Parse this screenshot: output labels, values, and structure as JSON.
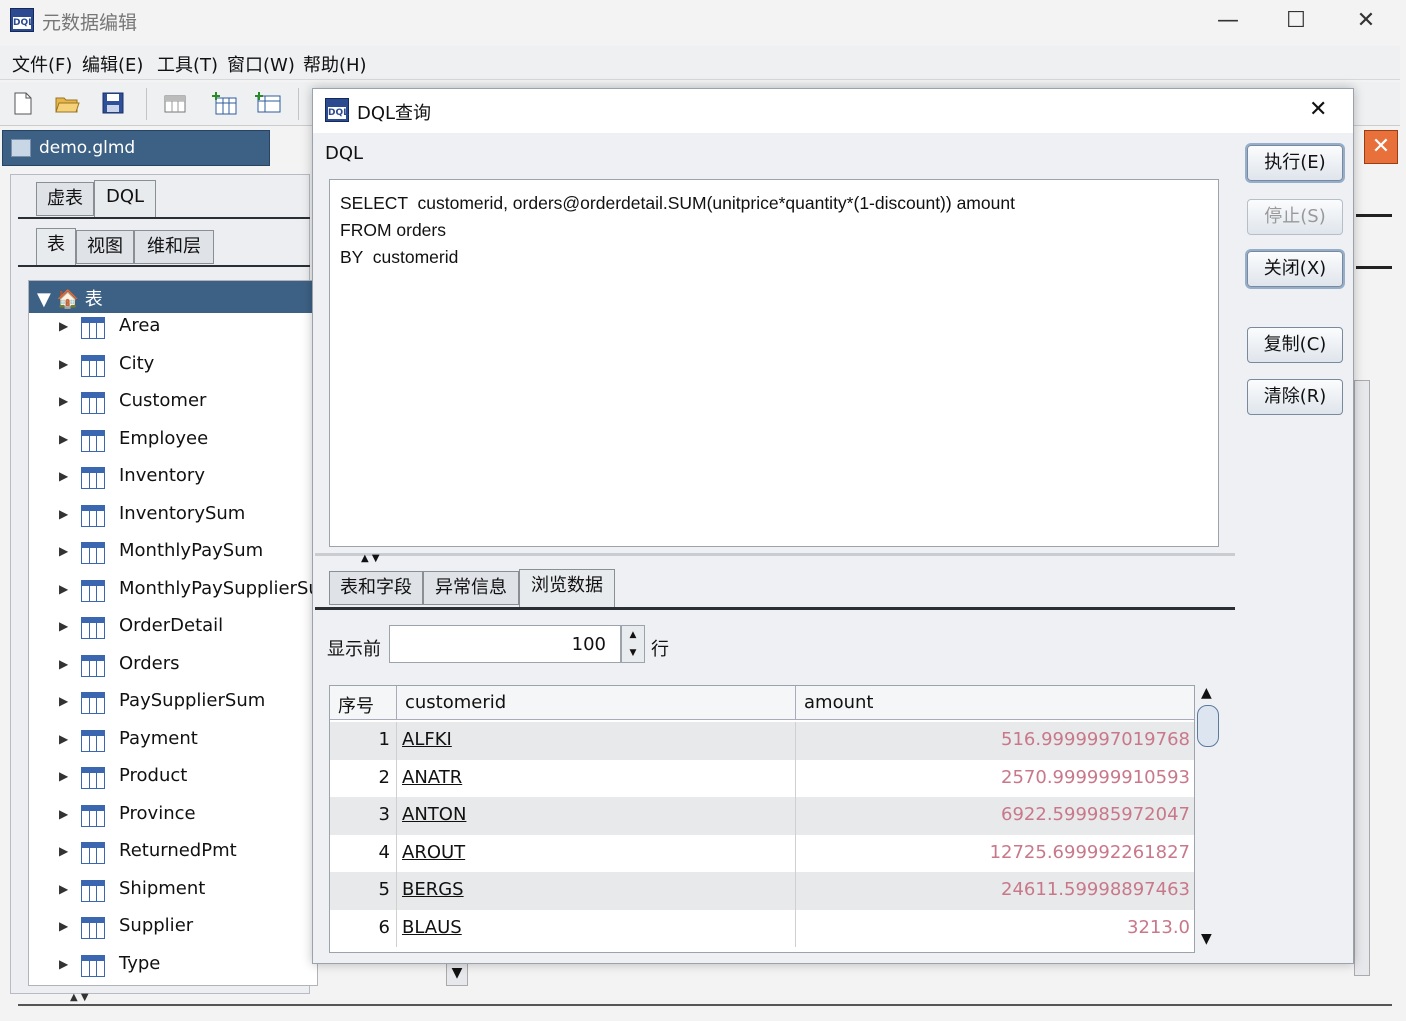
{
  "window": {
    "title": "元数据编辑"
  },
  "menubar": {
    "items": [
      "文件(F)",
      "编辑(E)",
      "工具(T)",
      "窗口(W)",
      "帮助(H)"
    ]
  },
  "file_tab": {
    "label": "demo.glmd"
  },
  "left_tabs": [
    "虚表",
    "DQL"
  ],
  "sub_tabs": [
    "表",
    "视图",
    "维和层"
  ],
  "tree": {
    "root": "表",
    "items": [
      "Area",
      "City",
      "Customer",
      "Employee",
      "Inventory",
      "InventorySum",
      "MonthlyPaySum",
      "MonthlyPaySupplierSum",
      "OrderDetail",
      "Orders",
      "PaySupplierSum",
      "Payment",
      "Product",
      "Province",
      "ReturnedPmt",
      "Shipment",
      "Supplier",
      "Type"
    ]
  },
  "dialog": {
    "title": "DQL查询",
    "section_label": "DQL",
    "query_lines": [
      "SELECT  customerid, orders@orderdetail.SUM(unitprice*quantity*(1-discount)) amount",
      "FROM orders",
      "BY  customerid"
    ],
    "buttons": {
      "execute": "执行(E)",
      "stop": "停止(S)",
      "close": "关闭(X)",
      "copy": "复制(C)",
      "clear": "清除(R)"
    },
    "result_tabs": [
      "表和字段",
      "异常信息",
      "浏览数据"
    ],
    "show_prefix": "显示前",
    "show_count": "100",
    "show_suffix": "行",
    "grid": {
      "headers": [
        "序号",
        "customerid",
        "amount"
      ],
      "rows": [
        [
          "1",
          "ALFKI",
          "516.9999997019768"
        ],
        [
          "2",
          "ANATR",
          "2570.999999910593"
        ],
        [
          "3",
          "ANTON",
          "6922.599985972047"
        ],
        [
          "4",
          "AROUT",
          "12725.699992261827"
        ],
        [
          "5",
          "BERGS",
          "24611.59998897463"
        ],
        [
          "6",
          "BLAUS",
          "3213.0"
        ]
      ]
    }
  },
  "colors": {
    "accent": "#3d6185",
    "value_text": "#c8788a"
  }
}
